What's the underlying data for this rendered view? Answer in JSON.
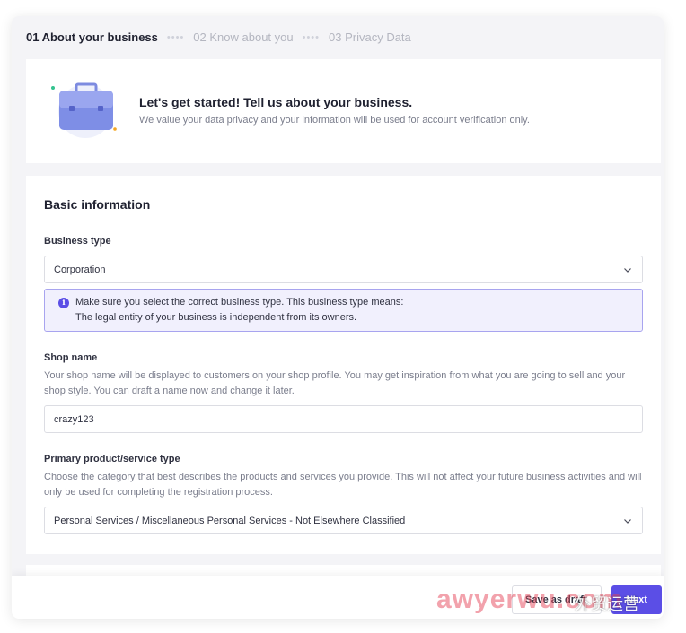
{
  "stepper": {
    "steps": [
      {
        "label": "01 About your business"
      },
      {
        "label": "02 Know about you"
      },
      {
        "label": "03 Privacy Data"
      }
    ],
    "separator": "••••"
  },
  "intro": {
    "icon": "briefcase-icon",
    "title": "Let's get started! Tell us about your business.",
    "subtitle": "We value your data privacy and your information will be used for account verification only."
  },
  "form": {
    "section_title": "Basic information",
    "business_type": {
      "label": "Business type",
      "value": "Corporation",
      "info_line1": "Make sure you select the correct business type. This business type means:",
      "info_line2": "The legal entity of your business is independent from its owners."
    },
    "shop_name": {
      "label": "Shop name",
      "help": "Your shop name will be displayed to customers on your shop profile. You may get inspiration from what you are going to sell and your shop style. You can draft a name now and change it later.",
      "value": "crazy123"
    },
    "product_type": {
      "label": "Primary product/service type",
      "help": "Choose the category that best describes the products and services you provide. This will not affect your future business activities and will only be used for completing the registration process.",
      "value": "Personal Services / Miscellaneous Personal Services - Not Elsewhere Classified"
    }
  },
  "footer": {
    "save_label": "Save as draft",
    "next_label": "Next"
  },
  "watermark": {
    "text": "awyerwu.com",
    "cn": "外贸运营"
  },
  "colors": {
    "accent": "#5b4ee6",
    "info_bg": "#f1f0fd",
    "page_bg": "#f4f4f7"
  }
}
